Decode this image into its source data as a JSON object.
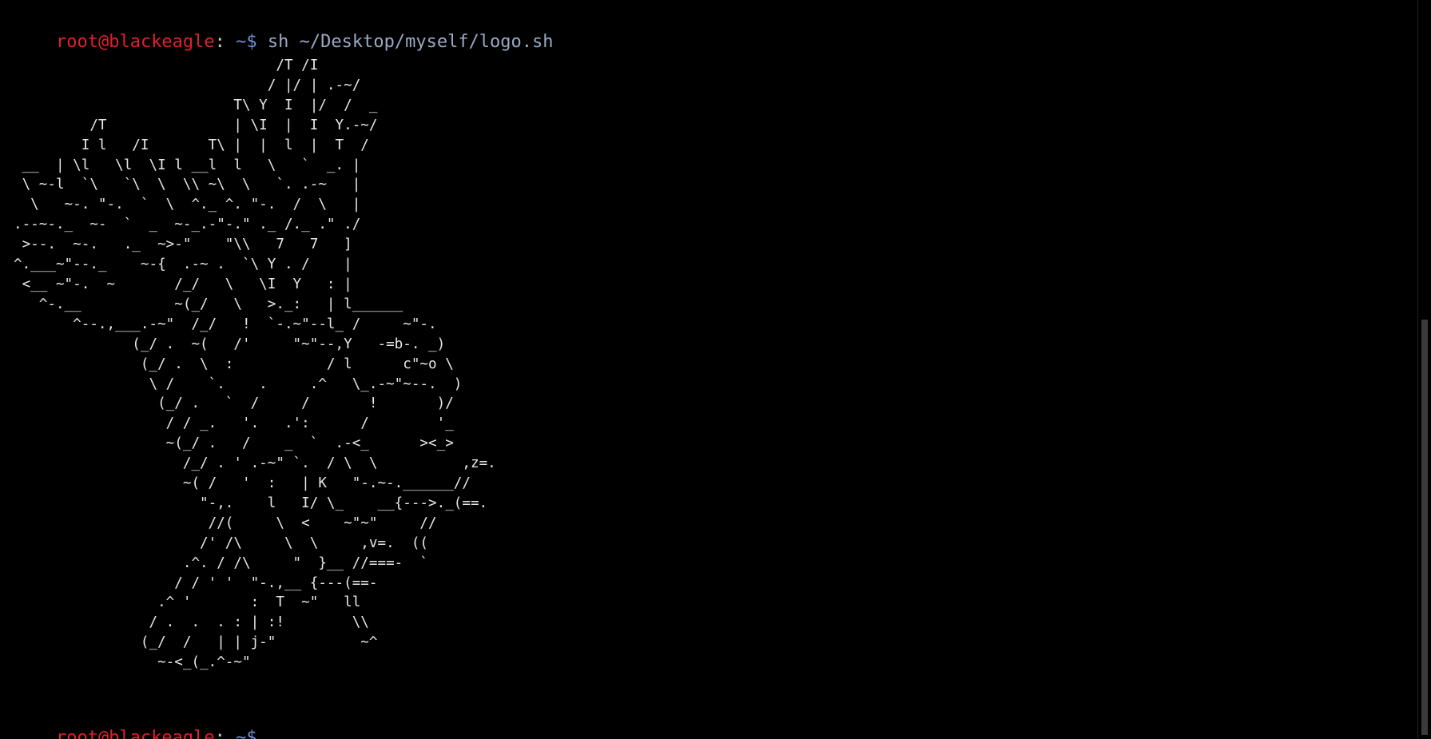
{
  "prompt": {
    "user_host": "root@blackeagle",
    "separator": ":",
    "path": " ~$ "
  },
  "first_command": "sh ~/Desktop/myself/logo.sh",
  "logo_art": "                               /T /I\n                              / |/ | .-~/\n                          T\\ Y  I  |/  /  _\n         /T               | \\I  |  I  Y.-~/\n        I l   /I       T\\ |  |  l  |  T  /\n __  | \\l   \\l  \\I l __l  l   \\   `  _. |\n \\ ~-l  `\\   `\\  \\  \\\\ ~\\  \\   `. .-~   |\n  \\   ~-. \"-.  `  \\  ^._ ^. \"-.  /  \\   |\n.--~-._  ~-  `  _  ~-_.-\"-.\" ._ /._ .\" ./\n >--.  ~-.   ._  ~>-\"    \"\\\\   7   7   ]\n^.___~\"--._    ~-{  .-~ .  `\\ Y . /    |\n <__ ~\"-.  ~       /_/   \\   \\I  Y   : |\n   ^-.__           ~(_/   \\   >._:   | l______\n       ^--.,___.-~\"  /_/   !  `-.~\"--l_ /     ~\"-.\n              (_/ .  ~(   /'     \"~\"--,Y   -=b-. _)\n               (_/ .  \\  :           / l      c\"~o \\\n                \\ /    `.    .     .^   \\_.-~\"~--.  )\n                 (_/ .   `  /     /       !       )/\n                  / / _.   '.   .':      /        '_\n                  ~(_/ .   /    _  `  .-<_      ><_>\n                    /_/ . ' .-~\" `.  / \\  \\          ,z=.\n                    ~( /   '  :   | K   \"-.~-.______//\n                      \"-,.    l   I/ \\_    __{--->._(==.\n                       //(     \\  <    ~\"~\"     //\n                      /' /\\     \\  \\     ,v=.  ((\n                    .^. / /\\     \"  }__ //===-  `\n                   / / ' '  \"-.,__ {---(==-\n                 .^ '       :  T  ~\"   ll\n                / .  .  . : | :!        \\\\\n               (_/  /   | | j-\"          ~^\n                 ~-<_(_.^-~\""
}
